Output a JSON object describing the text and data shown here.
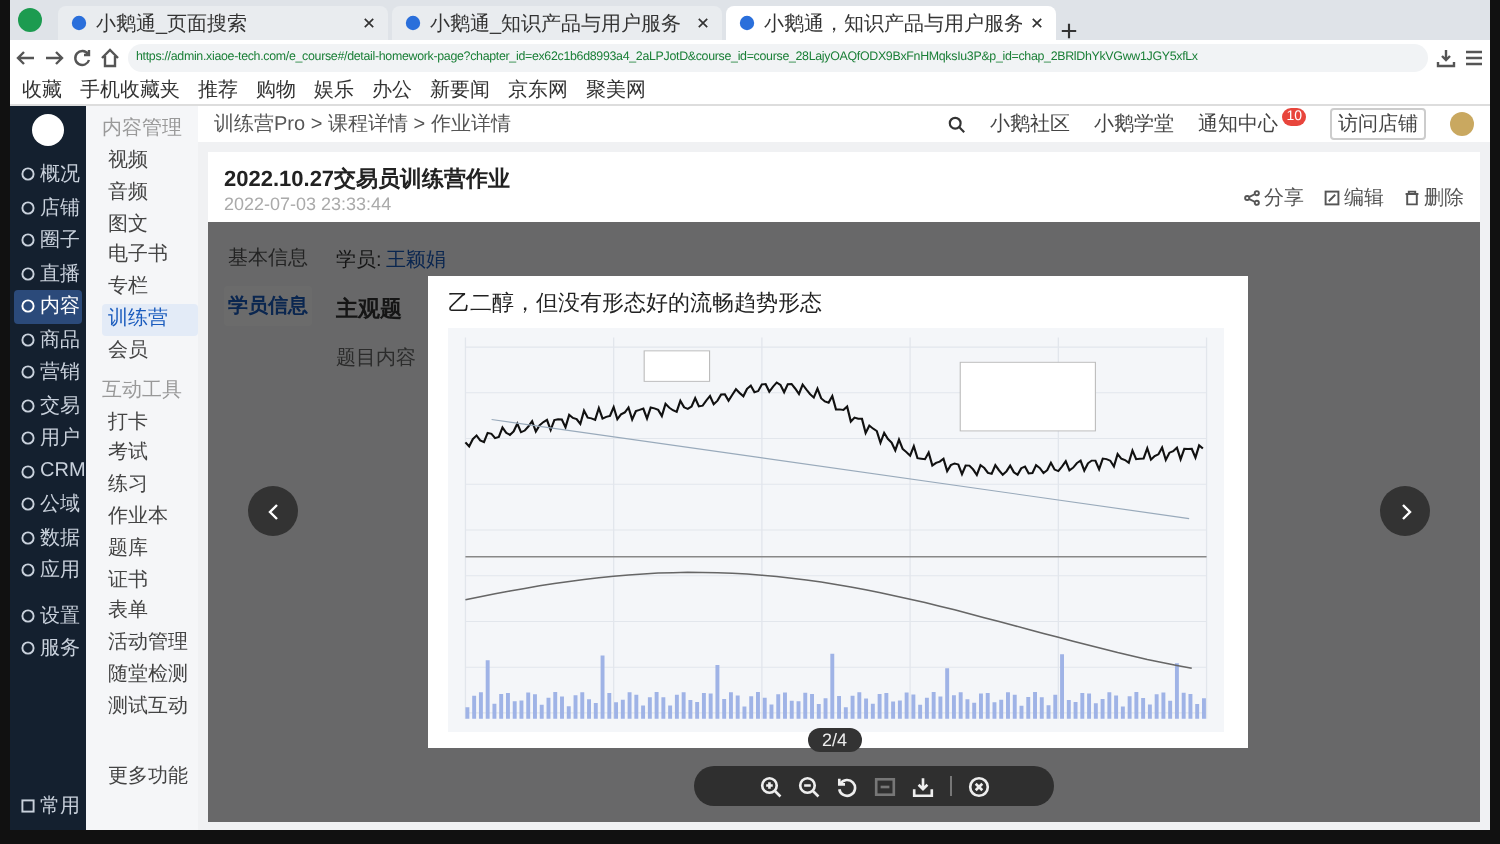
{
  "browser": {
    "tabs": [
      {
        "title": "小鹅通_页面搜索",
        "selected": false
      },
      {
        "title": "小鹅通_知识产品与用户服务",
        "selected": false
      },
      {
        "title": "小鹅通，知识产品与用户服务",
        "selected": true
      }
    ],
    "url": "https://admin.xiaoe-tech.com/e_course#/detail-homework-page?chapter_id=ex62c1b6d8993a4_2aLPJotD&course_id=course_28LajyOAQfODX9BxFnHMqksIu3P&p_id=chap_2BRlDhYkVGww1JGY5xfLx",
    "bookmarks": [
      "收藏",
      "手机收藏夹",
      "推荐",
      "购物",
      "娱乐",
      "办公",
      "新要闻",
      "京东网",
      "聚美网"
    ]
  },
  "nav": {
    "items": [
      {
        "label": "概况",
        "selected": false
      },
      {
        "label": "店铺",
        "selected": false
      },
      {
        "label": "圈子",
        "selected": false
      },
      {
        "label": "直播",
        "selected": false
      },
      {
        "label": "内容",
        "selected": true
      },
      {
        "label": "商品",
        "selected": false
      },
      {
        "label": "营销",
        "selected": false
      },
      {
        "label": "交易",
        "selected": false
      },
      {
        "label": "用户",
        "selected": false
      },
      {
        "label": "CRM",
        "selected": false
      },
      {
        "label": "公域",
        "selected": false
      },
      {
        "label": "数据",
        "selected": false
      },
      {
        "label": "应用",
        "selected": false
      },
      {
        "label": "设置",
        "selected": false
      },
      {
        "label": "服务",
        "selected": false
      }
    ],
    "bottom": "常用"
  },
  "subnav": {
    "sections": [
      {
        "title": "内容管理",
        "items": [
          {
            "label": "视频",
            "selected": false
          },
          {
            "label": "音频",
            "selected": false
          },
          {
            "label": "图文",
            "selected": false
          },
          {
            "label": "电子书",
            "selected": false
          },
          {
            "label": "专栏",
            "selected": false
          },
          {
            "label": "训练营",
            "selected": true
          },
          {
            "label": "会员",
            "selected": false
          }
        ]
      },
      {
        "title": "互动工具",
        "items": [
          {
            "label": "打卡",
            "selected": false
          },
          {
            "label": "考试",
            "selected": false
          },
          {
            "label": "练习",
            "selected": false
          },
          {
            "label": "作业本",
            "selected": false
          },
          {
            "label": "题库",
            "selected": false
          },
          {
            "label": "证书",
            "selected": false
          },
          {
            "label": "表单",
            "selected": false
          },
          {
            "label": "活动管理",
            "selected": false
          },
          {
            "label": "随堂检测",
            "selected": false
          },
          {
            "label": "测试互动",
            "selected": false
          }
        ]
      }
    ],
    "more": "更多功能"
  },
  "header": {
    "breadcrumb": "训练营Pro > 课程详情 > 作业详情",
    "links": [
      {
        "label": "小鹅社区"
      },
      {
        "label": "小鹅学堂"
      },
      {
        "label": "通知中心",
        "badge": "10"
      },
      {
        "label": "访问店铺"
      }
    ]
  },
  "page": {
    "title": "2022.10.27交易员训练营作业",
    "date": "2022-07-03 23:33:44",
    "actions": [
      "分享",
      "编辑",
      "删除"
    ],
    "tabs": [
      {
        "label": "基本信息",
        "selected": false
      },
      {
        "label": "学员信息",
        "selected": true
      }
    ],
    "student_label": "学员:",
    "student_name": "王颖娟",
    "section": "主观题",
    "question_label": "题目内容"
  },
  "viewer": {
    "caption": "乙二醇，但没有形态好的流畅趋势形态",
    "counter": "2/4",
    "tools": [
      {
        "kind": "zoom-in",
        "disabled": false
      },
      {
        "kind": "zoom-out",
        "disabled": false
      },
      {
        "kind": "rotate",
        "disabled": false
      },
      {
        "kind": "fit",
        "disabled": true
      },
      {
        "kind": "download",
        "disabled": false
      },
      {
        "kind": "close",
        "disabled": false
      }
    ]
  }
}
